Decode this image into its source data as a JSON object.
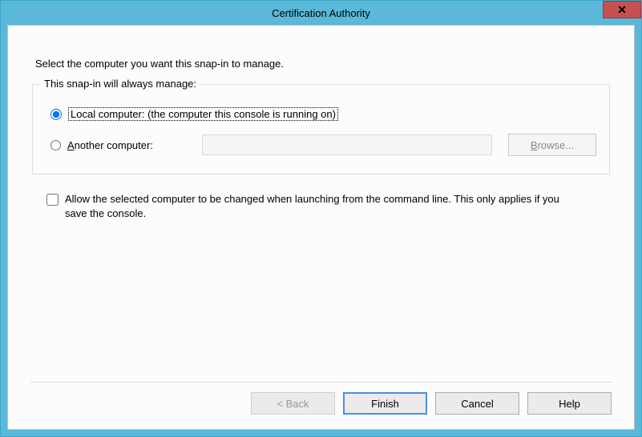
{
  "title": "Certification Authority",
  "instruction": "Select the computer you want this snap-in to manage.",
  "group": {
    "legend": "This snap-in will always manage:",
    "local_label": "Local computer:  (the computer this console is running on)",
    "another_label": "Another computer:",
    "another_value": "",
    "browse_label": "Browse..."
  },
  "allow_change_label": "Allow the selected computer to be changed when launching from the command line. This only applies if you save the console.",
  "buttons": {
    "back": "< Back",
    "finish": "Finish",
    "cancel": "Cancel",
    "help": "Help"
  }
}
